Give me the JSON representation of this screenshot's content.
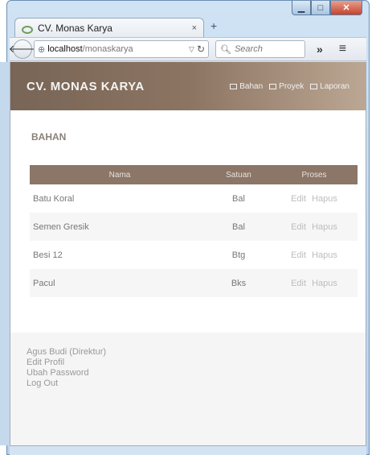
{
  "browser": {
    "tab_title": "CV. Monas Karya",
    "tab_close": "×",
    "new_tab": "+",
    "url_host": "localhost",
    "url_path": "/monaskarya",
    "search_placeholder": "Search",
    "overflow": "»",
    "menu": "≡"
  },
  "app": {
    "brand": "CV. MONAS KARYA",
    "nav": [
      {
        "label": "Bahan"
      },
      {
        "label": "Proyek"
      },
      {
        "label": "Laporan"
      }
    ]
  },
  "page": {
    "heading": "BAHAN",
    "table": {
      "headers": {
        "nama": "Nama",
        "satuan": "Satuan",
        "proses": "Proses"
      },
      "rows": [
        {
          "nama": "Batu Koral",
          "satuan": "Bal",
          "edit": "Edit",
          "hapus": "Hapus"
        },
        {
          "nama": "Semen Gresik",
          "satuan": "Bal",
          "edit": "Edit",
          "hapus": "Hapus"
        },
        {
          "nama": "Besi 12",
          "satuan": "Btg",
          "edit": "Edit",
          "hapus": "Hapus"
        },
        {
          "nama": "Pacul",
          "satuan": "Bks",
          "edit": "Edit",
          "hapus": "Hapus"
        }
      ]
    }
  },
  "footer": {
    "user": "Agus Budi (Direktur)",
    "links": [
      "Edit Profil",
      "Ubah Password",
      "Log Out"
    ]
  },
  "colors": {
    "header_brown": "#8c7462",
    "table_header": "#8b7667",
    "action_link": "#bdbdbd"
  }
}
